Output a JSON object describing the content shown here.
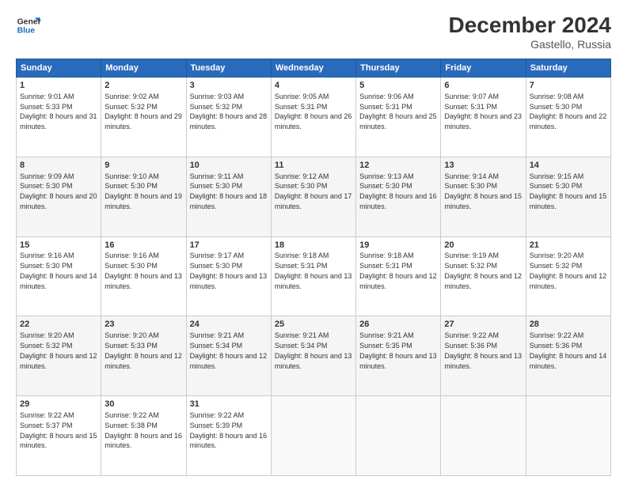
{
  "header": {
    "logo_line1": "General",
    "logo_line2": "Blue",
    "month": "December 2024",
    "location": "Gastello, Russia"
  },
  "days_of_week": [
    "Sunday",
    "Monday",
    "Tuesday",
    "Wednesday",
    "Thursday",
    "Friday",
    "Saturday"
  ],
  "weeks": [
    [
      {
        "day": "1",
        "sunrise": "9:01 AM",
        "sunset": "5:33 PM",
        "daylight": "8 hours and 31 minutes."
      },
      {
        "day": "2",
        "sunrise": "9:02 AM",
        "sunset": "5:32 PM",
        "daylight": "8 hours and 29 minutes."
      },
      {
        "day": "3",
        "sunrise": "9:03 AM",
        "sunset": "5:32 PM",
        "daylight": "8 hours and 28 minutes."
      },
      {
        "day": "4",
        "sunrise": "9:05 AM",
        "sunset": "5:31 PM",
        "daylight": "8 hours and 26 minutes."
      },
      {
        "day": "5",
        "sunrise": "9:06 AM",
        "sunset": "5:31 PM",
        "daylight": "8 hours and 25 minutes."
      },
      {
        "day": "6",
        "sunrise": "9:07 AM",
        "sunset": "5:31 PM",
        "daylight": "8 hours and 23 minutes."
      },
      {
        "day": "7",
        "sunrise": "9:08 AM",
        "sunset": "5:30 PM",
        "daylight": "8 hours and 22 minutes."
      }
    ],
    [
      {
        "day": "8",
        "sunrise": "9:09 AM",
        "sunset": "5:30 PM",
        "daylight": "8 hours and 20 minutes."
      },
      {
        "day": "9",
        "sunrise": "9:10 AM",
        "sunset": "5:30 PM",
        "daylight": "8 hours and 19 minutes."
      },
      {
        "day": "10",
        "sunrise": "9:11 AM",
        "sunset": "5:30 PM",
        "daylight": "8 hours and 18 minutes."
      },
      {
        "day": "11",
        "sunrise": "9:12 AM",
        "sunset": "5:30 PM",
        "daylight": "8 hours and 17 minutes."
      },
      {
        "day": "12",
        "sunrise": "9:13 AM",
        "sunset": "5:30 PM",
        "daylight": "8 hours and 16 minutes."
      },
      {
        "day": "13",
        "sunrise": "9:14 AM",
        "sunset": "5:30 PM",
        "daylight": "8 hours and 15 minutes."
      },
      {
        "day": "14",
        "sunrise": "9:15 AM",
        "sunset": "5:30 PM",
        "daylight": "8 hours and 15 minutes."
      }
    ],
    [
      {
        "day": "15",
        "sunrise": "9:16 AM",
        "sunset": "5:30 PM",
        "daylight": "8 hours and 14 minutes."
      },
      {
        "day": "16",
        "sunrise": "9:16 AM",
        "sunset": "5:30 PM",
        "daylight": "8 hours and 13 minutes."
      },
      {
        "day": "17",
        "sunrise": "9:17 AM",
        "sunset": "5:30 PM",
        "daylight": "8 hours and 13 minutes."
      },
      {
        "day": "18",
        "sunrise": "9:18 AM",
        "sunset": "5:31 PM",
        "daylight": "8 hours and 13 minutes."
      },
      {
        "day": "19",
        "sunrise": "9:18 AM",
        "sunset": "5:31 PM",
        "daylight": "8 hours and 12 minutes."
      },
      {
        "day": "20",
        "sunrise": "9:19 AM",
        "sunset": "5:32 PM",
        "daylight": "8 hours and 12 minutes."
      },
      {
        "day": "21",
        "sunrise": "9:20 AM",
        "sunset": "5:32 PM",
        "daylight": "8 hours and 12 minutes."
      }
    ],
    [
      {
        "day": "22",
        "sunrise": "9:20 AM",
        "sunset": "5:32 PM",
        "daylight": "8 hours and 12 minutes."
      },
      {
        "day": "23",
        "sunrise": "9:20 AM",
        "sunset": "5:33 PM",
        "daylight": "8 hours and 12 minutes."
      },
      {
        "day": "24",
        "sunrise": "9:21 AM",
        "sunset": "5:34 PM",
        "daylight": "8 hours and 12 minutes."
      },
      {
        "day": "25",
        "sunrise": "9:21 AM",
        "sunset": "5:34 PM",
        "daylight": "8 hours and 13 minutes."
      },
      {
        "day": "26",
        "sunrise": "9:21 AM",
        "sunset": "5:35 PM",
        "daylight": "8 hours and 13 minutes."
      },
      {
        "day": "27",
        "sunrise": "9:22 AM",
        "sunset": "5:36 PM",
        "daylight": "8 hours and 13 minutes."
      },
      {
        "day": "28",
        "sunrise": "9:22 AM",
        "sunset": "5:36 PM",
        "daylight": "8 hours and 14 minutes."
      }
    ],
    [
      {
        "day": "29",
        "sunrise": "9:22 AM",
        "sunset": "5:37 PM",
        "daylight": "8 hours and 15 minutes."
      },
      {
        "day": "30",
        "sunrise": "9:22 AM",
        "sunset": "5:38 PM",
        "daylight": "8 hours and 16 minutes."
      },
      {
        "day": "31",
        "sunrise": "9:22 AM",
        "sunset": "5:39 PM",
        "daylight": "8 hours and 16 minutes."
      },
      null,
      null,
      null,
      null
    ]
  ]
}
